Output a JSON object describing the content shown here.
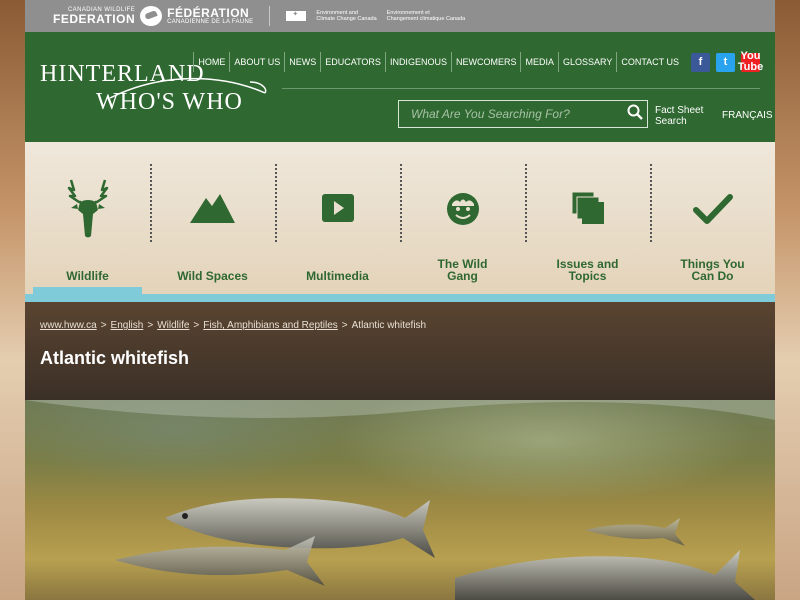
{
  "topbar": {
    "cwf_en_small": "CANADIAN WILDLIFE",
    "cwf_en_big": "FEDERATION",
    "cwf_fr_big": "FÉDÉRATION",
    "cwf_fr_small": "CANADIENNE DE LA FAUNE",
    "gc_en_1": "Environment and",
    "gc_en_2": "Climate Change Canada",
    "gc_fr_1": "Environnement et",
    "gc_fr_2": "Changement climatique Canada"
  },
  "header": {
    "logo_line1": "HINTERLAND",
    "logo_line2": "WHO'S WHO",
    "nav": [
      "HOME",
      "ABOUT US",
      "NEWS",
      "EDUCATORS",
      "INDIGENOUS",
      "NEWCOMERS",
      "MEDIA",
      "GLOSSARY",
      "CONTACT US"
    ],
    "social": {
      "facebook": "f",
      "twitter": "t",
      "youtube_top": "You",
      "youtube_bottom": "Tube"
    },
    "search_placeholder": "What Are You Searching For?",
    "fact_sheet_search": "Fact Sheet Search",
    "language": "FRANÇAIS"
  },
  "categories": [
    {
      "label": "Wildlife",
      "icon": "deer-head-icon",
      "active": true
    },
    {
      "label": "Wild Spaces",
      "icon": "mountain-icon",
      "active": false
    },
    {
      "label": "Multimedia",
      "icon": "play-icon",
      "active": false
    },
    {
      "label": "The Wild Gang",
      "icon": "face-icon",
      "active": false
    },
    {
      "label": "Issues and Topics",
      "icon": "stacked-pages-icon",
      "active": false
    },
    {
      "label": "Things You Can Do",
      "icon": "checkmark-icon",
      "active": false
    }
  ],
  "breadcrumb": {
    "items": [
      "www.hww.ca",
      "English",
      "Wildlife",
      "Fish, Amphibians and Reptiles"
    ],
    "current": "Atlantic whitefish"
  },
  "page_title": "Atlantic whitefish",
  "colors": {
    "header_green": "#2f6830",
    "accent_blue": "#7fcbd9",
    "topbar_gray": "#8f8f8f"
  }
}
